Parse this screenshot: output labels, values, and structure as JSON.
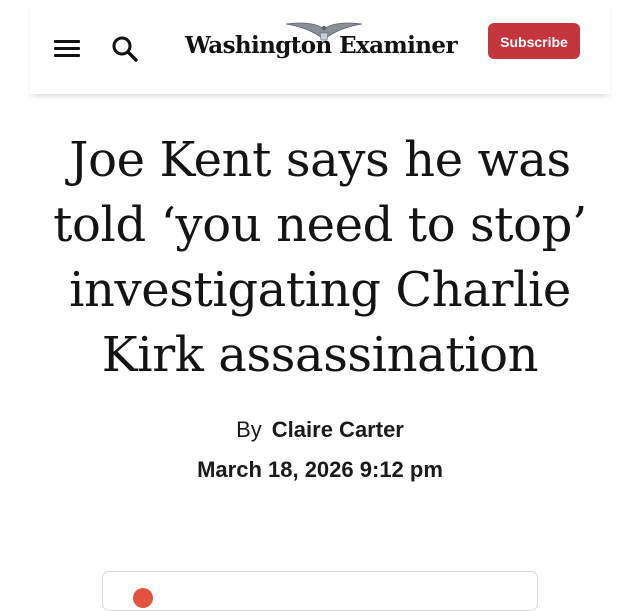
{
  "header": {
    "logo_text": "Washington Examiner",
    "subscribe_label": "Subscribe",
    "menu_icon": "hamburger-menu-icon",
    "search_icon": "search-icon"
  },
  "article": {
    "headline": "Joe Kent says he was told ‘you need to stop’ investigating Charlie Kirk assassination",
    "byline_prefix": "By",
    "author": "Claire Carter",
    "date": "March 18, 2026 9:12 pm"
  },
  "colors": {
    "accent": "#c4363d",
    "text": "#141414",
    "background": "#ffffff"
  }
}
